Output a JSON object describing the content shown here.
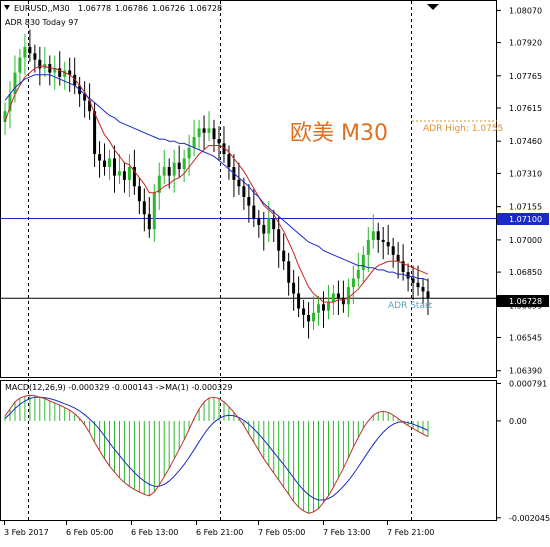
{
  "chart_data": {
    "type": "candlestick",
    "main_title": "EURUSD,,M30",
    "ohlc_readout": [
      "1.06778",
      "1.06786",
      "1.06726",
      "1.06728"
    ],
    "indicator_line": "ADR 830   Today 97",
    "watermark": "欧美 M30",
    "adr_high_label": "ADR High: 1.0755",
    "adr_start_label": "ADR Start",
    "hline_label_blue": "1.07100",
    "hline_label_current": "1.06728",
    "price_axis_ticks": [
      "1.08070",
      "1.07920",
      "1.07765",
      "1.07615",
      "1.07460",
      "1.07310",
      "1.07155",
      "1.07000",
      "1.06850",
      "1.06695",
      "1.06545",
      "1.06390"
    ],
    "price_range": [
      1.0637,
      1.081
    ],
    "time_labels": [
      "3 Feb 2017",
      "6 Feb 05:00",
      "6 Feb 13:00",
      "6 Feb 21:00",
      "7 Feb 05:00",
      "7 Feb 13:00",
      "7 Feb 21:00"
    ],
    "macd_title": "MACD(12,26,9) -0.000329 -0.000143 ->MA(1) -0.000329",
    "macd_axis_ticks": [
      "0.000791",
      "0.00",
      "-0.002045"
    ],
    "macd_range": [
      -0.00207,
      0.00082
    ],
    "closes": [
      1.076,
      1.0768,
      1.0778,
      1.0785,
      1.079,
      1.0787,
      1.0784,
      1.078,
      1.0782,
      1.0778,
      1.078,
      1.0776,
      1.0779,
      1.0777,
      1.0772,
      1.0768,
      1.0765,
      1.076,
      1.074,
      1.0737,
      1.0734,
      1.0738,
      1.073,
      1.0732,
      1.0728,
      1.0734,
      1.0725,
      1.0718,
      1.0712,
      1.0705,
      1.0722,
      1.073,
      1.0734,
      1.073,
      1.0736,
      1.0733,
      1.0738,
      1.0743,
      1.0748,
      1.0752,
      1.075,
      1.0752,
      1.0747,
      1.0745,
      1.074,
      1.0734,
      1.0728,
      1.0725,
      1.072,
      1.0716,
      1.071,
      1.0707,
      1.0703,
      1.071,
      1.0705,
      1.0695,
      1.069,
      1.068,
      1.0675,
      1.0668,
      1.0665,
      1.0662,
      1.0666,
      1.067,
      1.0667,
      1.0671,
      1.0675,
      1.0673,
      1.067,
      1.0678,
      1.0682,
      1.0686,
      1.0693,
      1.07,
      1.0704,
      1.07,
      1.0699,
      1.0697,
      1.0693,
      1.069,
      1.0685,
      1.0682,
      1.068,
      1.0678,
      1.0676,
      1.0673
    ],
    "ma_red": [
      1.0755,
      1.0762,
      1.0768,
      1.0772,
      1.0776,
      1.0778,
      1.078,
      1.0781,
      1.0781,
      1.078,
      1.078,
      1.0779,
      1.0778,
      1.0777,
      1.0775,
      1.0772,
      1.0769,
      1.0765,
      1.0759,
      1.0754,
      1.0749,
      1.0746,
      1.0742,
      1.0739,
      1.0736,
      1.0735,
      1.0732,
      1.0729,
      1.0726,
      1.0722,
      1.0722,
      1.0723,
      1.0725,
      1.0726,
      1.0728,
      1.0729,
      1.0731,
      1.0734,
      1.0737,
      1.074,
      1.0742,
      1.0744,
      1.0744,
      1.0744,
      1.0743,
      1.0741,
      1.0738,
      1.0735,
      1.0732,
      1.0728,
      1.0724,
      1.072,
      1.0716,
      1.0714,
      1.0712,
      1.0708,
      1.0704,
      1.0699,
      1.0694,
      1.0688,
      1.0683,
      1.0678,
      1.0675,
      1.0673,
      1.0671,
      1.0671,
      1.0671,
      1.0672,
      1.0672,
      1.0673,
      1.0675,
      1.0677,
      1.068,
      1.0683,
      1.0686,
      1.0688,
      1.0689,
      1.069,
      1.069,
      1.069,
      1.0689,
      1.0688,
      1.0687,
      1.0686,
      1.0685,
      1.0684
    ],
    "ma_blue": [
      1.0765,
      1.0768,
      1.0771,
      1.0773,
      1.0775,
      1.0776,
      1.0777,
      1.0777,
      1.0777,
      1.0777,
      1.0776,
      1.0775,
      1.0774,
      1.0773,
      1.0772,
      1.077,
      1.0768,
      1.0766,
      1.0764,
      1.0762,
      1.076,
      1.0758,
      1.0757,
      1.0755,
      1.0754,
      1.0753,
      1.0752,
      1.0751,
      1.075,
      1.0749,
      1.0748,
      1.0747,
      1.0747,
      1.0746,
      1.0746,
      1.0745,
      1.0745,
      1.0744,
      1.0743,
      1.0742,
      1.0741,
      1.074,
      1.0739,
      1.0737,
      1.0735,
      1.0733,
      1.0731,
      1.0729,
      1.0727,
      1.0725,
      1.0722,
      1.072,
      1.0717,
      1.0715,
      1.0713,
      1.0711,
      1.0709,
      1.0707,
      1.0705,
      1.0703,
      1.0701,
      1.0699,
      1.0698,
      1.0697,
      1.0695,
      1.0694,
      1.0693,
      1.0692,
      1.0691,
      1.069,
      1.0689,
      1.0688,
      1.0688,
      1.0687,
      1.0687,
      1.0686,
      1.0686,
      1.0685,
      1.0685,
      1.0684,
      1.0684,
      1.0683,
      1.0683,
      1.0682,
      1.0682,
      1.0681
    ],
    "macd_hist": [
      0.0001,
      0.00025,
      0.0004,
      0.00048,
      0.00052,
      0.00054,
      0.00053,
      0.0005,
      0.00047,
      0.00042,
      0.00038,
      0.00033,
      0.00028,
      0.00023,
      0.00015,
      5e-05,
      -8e-05,
      -0.00025,
      -0.00045,
      -0.00063,
      -0.0008,
      -0.00095,
      -0.00108,
      -0.0012,
      -0.0013,
      -0.00138,
      -0.00145,
      -0.0015,
      -0.00155,
      -0.00158,
      -0.0015,
      -0.00135,
      -0.00118,
      -0.001,
      -0.0008,
      -0.0006,
      -0.0004,
      -0.00018,
      5e-05,
      0.00025,
      0.0004,
      0.00048,
      0.0005,
      0.00047,
      0.0004,
      0.0003,
      0.00018,
      5e-05,
      -0.0001,
      -0.00028,
      -0.00045,
      -0.00062,
      -0.0008,
      -0.00095,
      -0.0011,
      -0.00125,
      -0.0014,
      -0.00155,
      -0.0017,
      -0.00182,
      -0.0019,
      -0.00195,
      -0.00192,
      -0.00185,
      -0.00172,
      -0.00158,
      -0.0014,
      -0.0012,
      -0.001,
      -0.00078,
      -0.00055,
      -0.00035,
      -0.00015,
      0.0,
      0.00012,
      0.00018,
      0.0002,
      0.00018,
      0.00012,
      5e-05,
      -3e-05,
      -0.0001,
      -0.00016,
      -0.00022,
      -0.00028,
      -0.00033
    ],
    "macd_signal": [
      5e-05,
      0.00015,
      0.00026,
      0.00035,
      0.00042,
      0.00047,
      0.0005,
      0.0005,
      0.00049,
      0.00047,
      0.00044,
      0.0004,
      0.00036,
      0.00032,
      0.00027,
      0.00021,
      0.00013,
      4e-05,
      -6e-05,
      -0.00018,
      -0.00032,
      -0.00046,
      -0.0006,
      -0.00073,
      -0.00086,
      -0.00098,
      -0.00109,
      -0.00119,
      -0.00127,
      -0.00134,
      -0.00138,
      -0.00138,
      -0.00134,
      -0.00127,
      -0.00117,
      -0.00105,
      -0.00092,
      -0.00077,
      -0.00061,
      -0.00044,
      -0.00028,
      -0.00014,
      -3e-05,
      5e-05,
      0.0001,
      0.00012,
      0.00011,
      7e-05,
      1e-05,
      -7e-05,
      -0.00017,
      -0.00028,
      -0.0004,
      -0.00053,
      -0.00066,
      -0.00079,
      -0.00092,
      -0.00106,
      -0.0012,
      -0.00134,
      -0.00146,
      -0.00156,
      -0.00163,
      -0.00167,
      -0.00167,
      -0.00164,
      -0.00158,
      -0.00149,
      -0.00138,
      -0.00126,
      -0.00112,
      -0.00097,
      -0.00081,
      -0.00065,
      -0.0005,
      -0.00036,
      -0.00024,
      -0.00014,
      -7e-05,
      -3e-05,
      -2e-05,
      -4e-05,
      -7e-05,
      -0.00011,
      -0.00015,
      -0.0002
    ]
  },
  "colors": {
    "bull": "#2db82d",
    "bear": "#000000",
    "ma_red": "#cc2222",
    "ma_blue": "#1a2ac8",
    "hline_blue": "#1a2ac8",
    "watermark": "#e07020",
    "adr_high": "#e09030",
    "adr_start": "#5aa0c0",
    "macd_hist": "#2db82d",
    "macd_signal": "#c03030",
    "macd_main": "#1a2ac8"
  }
}
